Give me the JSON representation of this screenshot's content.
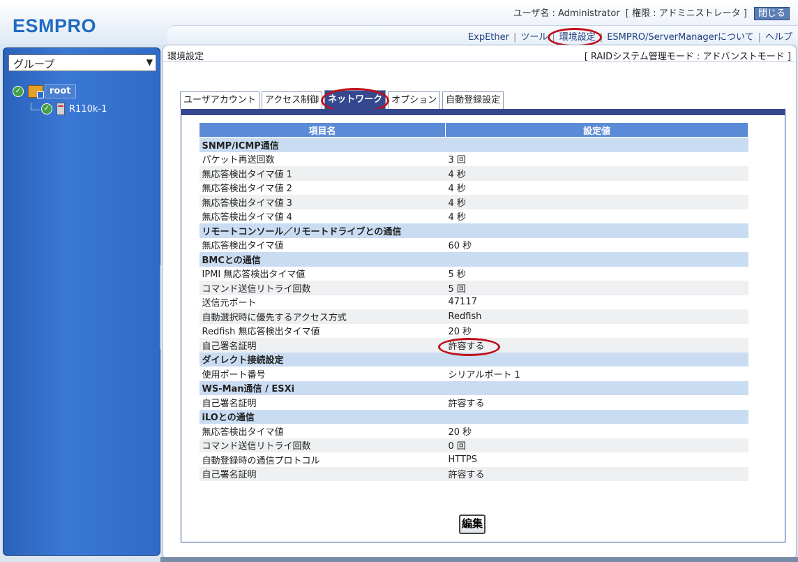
{
  "app": {
    "logo": "ESMPRO"
  },
  "header": {
    "user_text": "ユーザ名 : Administrator",
    "role_text": "[ 権限 : アドミニストレータ ]",
    "close_label": "閉じる",
    "menu": [
      "ExpEther",
      "ツール",
      "環境設定",
      "ESMPRO/ServerManagerについて",
      "ヘルプ"
    ],
    "active_menu_index": 2
  },
  "sidebar": {
    "group_select": "グループ",
    "tree": {
      "root": "root",
      "child": "R110k-1"
    }
  },
  "main": {
    "title": "環境設定",
    "mode": "[ RAIDシステム管理モード : アドバンストモード ]",
    "tabs": [
      "ユーザアカウント",
      "アクセス制御",
      "ネットワーク",
      "オプション",
      "自動登録設定"
    ],
    "active_tab_index": 2,
    "table": {
      "headers": [
        "項目名",
        "設定値"
      ],
      "rows": [
        {
          "type": "section",
          "name": "SNMP/ICMP通信"
        },
        {
          "type": "row",
          "name": "パケット再送回数",
          "value": "3 回"
        },
        {
          "type": "row",
          "name": "無応答検出タイマ値 1",
          "value": "4 秒"
        },
        {
          "type": "row",
          "name": "無応答検出タイマ値 2",
          "value": "4 秒"
        },
        {
          "type": "row",
          "name": "無応答検出タイマ値 3",
          "value": "4 秒"
        },
        {
          "type": "row",
          "name": "無応答検出タイマ値 4",
          "value": "4 秒"
        },
        {
          "type": "section",
          "name": "リモートコンソール／リモートドライブとの通信"
        },
        {
          "type": "row",
          "name": "無応答検出タイマ値",
          "value": "60 秒"
        },
        {
          "type": "section",
          "name": "BMCとの通信"
        },
        {
          "type": "row",
          "name": "IPMI 無応答検出タイマ値",
          "value": "5 秒"
        },
        {
          "type": "row",
          "name": "コマンド送信リトライ回数",
          "value": "5 回"
        },
        {
          "type": "row",
          "name": "送信元ポート",
          "value": "47117"
        },
        {
          "type": "row",
          "name": "自動選択時に優先するアクセス方式",
          "value": "Redfish"
        },
        {
          "type": "row",
          "name": "Redfish 無応答検出タイマ値",
          "value": "20 秒"
        },
        {
          "type": "row",
          "name": "自己署名証明",
          "value": "許容する",
          "highlight": true
        },
        {
          "type": "section",
          "name": "ダイレクト接続設定"
        },
        {
          "type": "row",
          "name": "使用ポート番号",
          "value": "シリアルポート 1"
        },
        {
          "type": "section",
          "name": "WS-Man通信 / ESXi"
        },
        {
          "type": "row",
          "name": "自己署名証明",
          "value": "許容する"
        },
        {
          "type": "section",
          "name": "iLOとの通信"
        },
        {
          "type": "row",
          "name": "無応答検出タイマ値",
          "value": "20 秒"
        },
        {
          "type": "row",
          "name": "コマンド送信リトライ回数",
          "value": "0 回"
        },
        {
          "type": "row",
          "name": "自動登録時の通信プロトコル",
          "value": "HTTPS"
        },
        {
          "type": "row",
          "name": "自己署名証明",
          "value": "許容する"
        }
      ]
    },
    "edit_label": "編集"
  },
  "colors": {
    "accent": "#35488f",
    "header_cell": "#5b8bd6",
    "section_bg": "#c9dcf2",
    "highlight": "#c0101a",
    "sidebar": "#2e69c4"
  }
}
